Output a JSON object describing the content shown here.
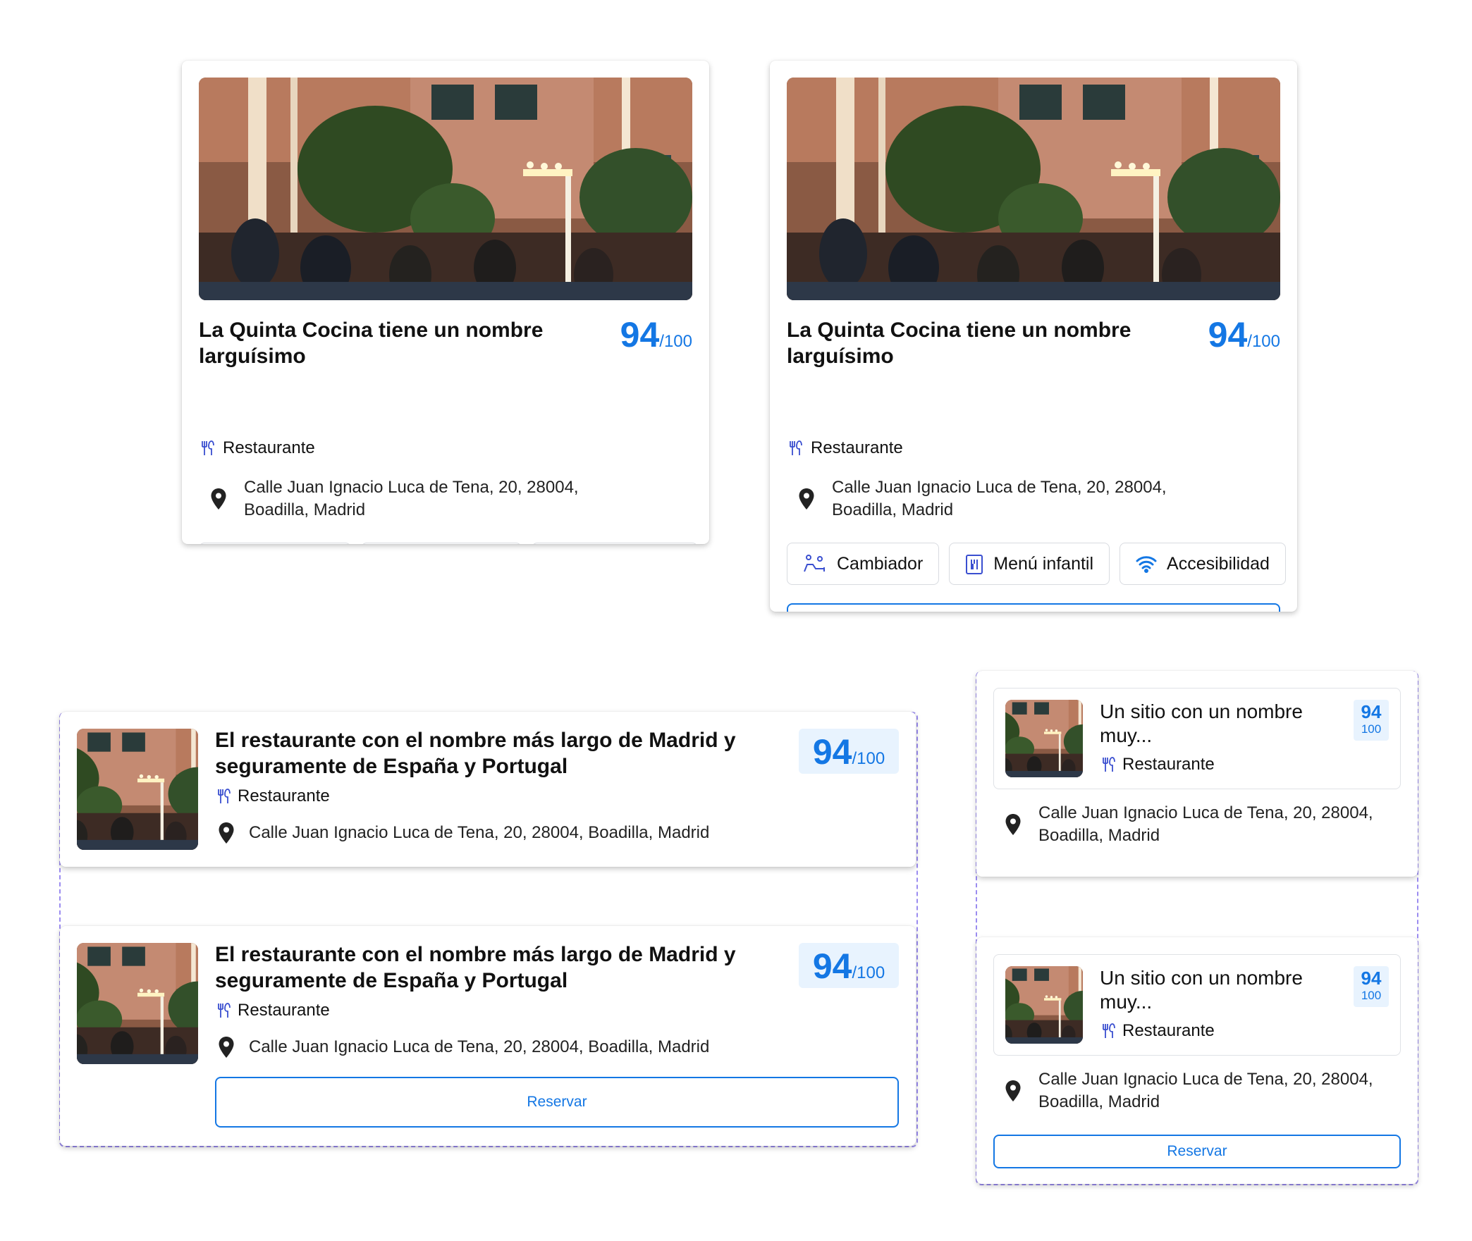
{
  "restaurant_long": {
    "title": "La Quinta Cocina tiene un nombre larguísimo",
    "score": "94",
    "score_den": "/100",
    "type": "Restaurante",
    "address": "Calle Juan Ignacio Luca de Tena, 20, 28004, Boadilla, Madrid",
    "chips": [
      "Cambiador",
      "Menú infantil",
      "Accesibilidad"
    ]
  },
  "restaurant_list": {
    "title": "El restaurante con el nombre más largo de Madrid y seguramente de España y Portugal",
    "score": "94",
    "score_den": "/100",
    "type": "Restaurante",
    "address": "Calle Juan Ignacio Luca de Tena, 20, 28004, Boadilla, Madrid"
  },
  "restaurant_compact": {
    "title": "Un sitio con un nombre muy...",
    "score": "94",
    "score_den": "100",
    "type": "Restaurante",
    "address": "Calle Juan Ignacio Luca de Tena, 20, 28004, Boadilla, Madrid"
  },
  "reserve_label": "Reservar",
  "colors": {
    "accent": "#1477e4",
    "score_bg": "#e8f3fe",
    "frame": "#9b8cf0",
    "icon": "#3a4fd0"
  }
}
